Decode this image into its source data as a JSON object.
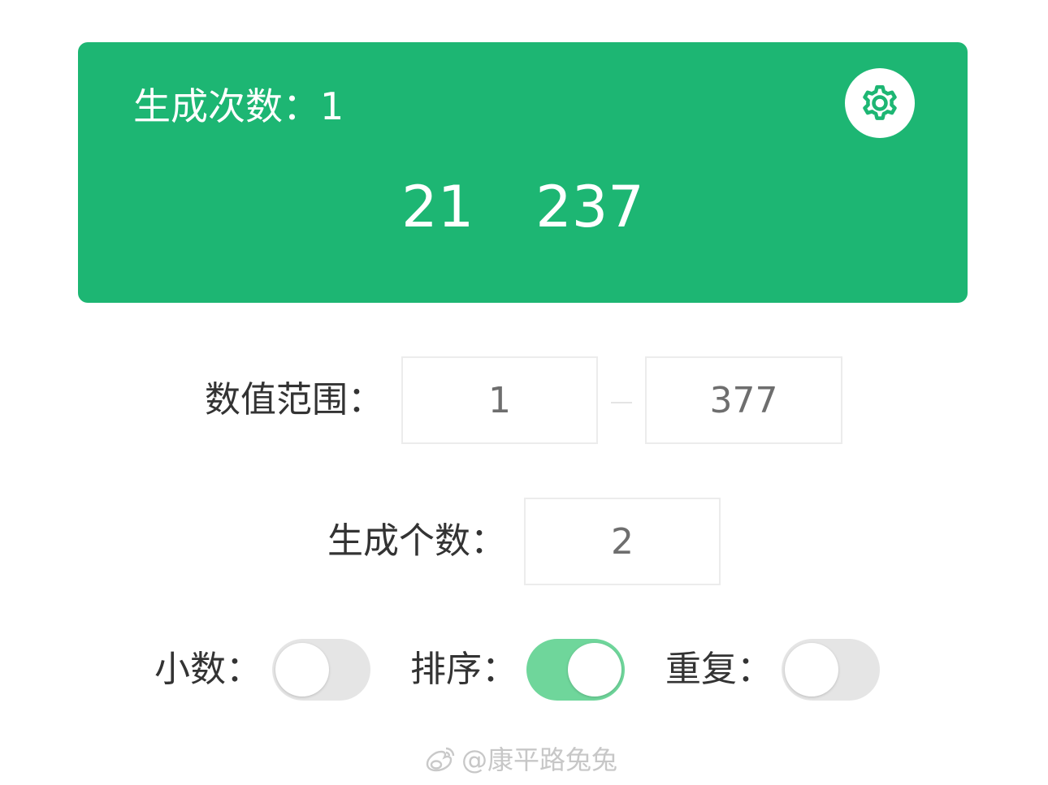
{
  "result": {
    "count_label": "生成次数：",
    "count_value": "1",
    "numbers": [
      "21",
      "237"
    ],
    "settings_icon": "gear-icon"
  },
  "range": {
    "label": "数值范围：",
    "min": "1",
    "max": "377"
  },
  "quantity": {
    "label": "生成个数：",
    "value": "2"
  },
  "toggles": {
    "decimal": {
      "label": "小数：",
      "on": false
    },
    "sort": {
      "label": "排序：",
      "on": true
    },
    "repeat": {
      "label": "重复：",
      "on": false
    }
  },
  "watermark": {
    "text": "@康平路兔兔",
    "icon": "weibo-icon"
  },
  "colors": {
    "brand_green": "#1db673",
    "toggle_on": "#6fd69b",
    "toggle_off": "#e5e5e5"
  }
}
